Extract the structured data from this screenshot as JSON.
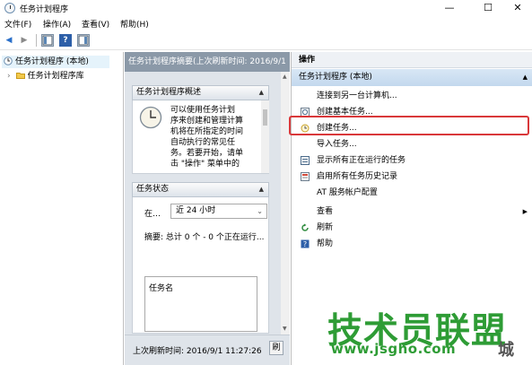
{
  "window": {
    "title": "任务计划程序",
    "min_glyph": "—",
    "max_glyph": "☐",
    "close_glyph": "✕"
  },
  "menubar": [
    "文件(F)",
    "操作(A)",
    "查看(V)",
    "帮助(H)"
  ],
  "toolbar": {
    "back_glyph": "◀",
    "forward_glyph": "▶",
    "help_glyph": "?"
  },
  "tree": {
    "root": "任务计划程序 (本地)",
    "child": "任务计划程序库",
    "expand_glyph": "›"
  },
  "center": {
    "header": "任务计划程序摘要(上次刷新时间: 2016/9/1",
    "overview": {
      "title": "任务计划程序概述",
      "caret": "▲",
      "text_lines": [
        "可以使用任务计划",
        "序来创建和管理计算",
        "机将在所指定的时间",
        "自动执行的常见任",
        "务。若要开始，请单",
        "击 \"操作\" 菜单中的"
      ]
    },
    "status": {
      "title": "任务状态",
      "caret": "▲",
      "range_label": "在…",
      "range_value": "近 24 小时",
      "summary": "摘要: 总计 0 个 - 0 个正在运行...",
      "task_col": "任务名"
    },
    "last_refresh": "上次刷新时间: 2016/9/1 11:27:26",
    "refresh_btn": "刷"
  },
  "actions": {
    "title": "操作",
    "group": "任务计划程序 (本地)",
    "group_caret": "▲",
    "items": [
      "连接到另一台计算机...",
      "创建基本任务...",
      "创建任务...",
      "导入任务...",
      "显示所有正在运行的任务",
      "启用所有任务历史记录",
      "AT 服务帐户配置",
      "查看",
      "刷新",
      "帮助"
    ],
    "submenu_glyph": "▶"
  },
  "watermark": {
    "main": "技术员联盟",
    "url": "www.jsgho.com",
    "corner": "城"
  },
  "colors": {
    "highlight": "#d9383a",
    "watermark": "#2e9c35",
    "pane_header": "#8b99a8"
  }
}
